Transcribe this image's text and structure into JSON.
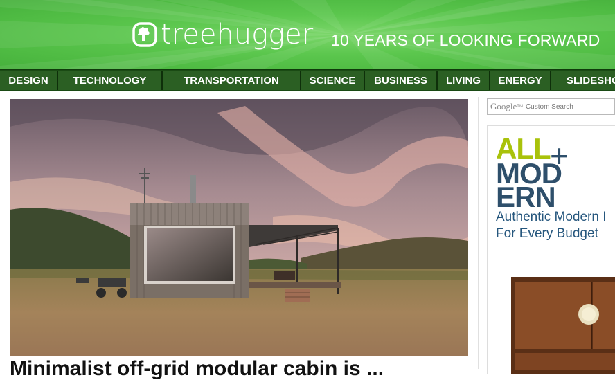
{
  "header": {
    "logo_text": "treehugger",
    "tagline": "10 YEARS OF LOOKING FORWARD"
  },
  "nav": {
    "items": [
      {
        "label": "DESIGN"
      },
      {
        "label": "TECHNOLOGY"
      },
      {
        "label": "TRANSPORTATION"
      },
      {
        "label": "SCIENCE"
      },
      {
        "label": "BUSINESS"
      },
      {
        "label": "LIVING"
      },
      {
        "label": "ENERGY"
      },
      {
        "label": "SLIDESHO"
      }
    ]
  },
  "article": {
    "title": "Minimalist off-grid modular cabin is ..."
  },
  "search": {
    "brand": "Google",
    "tm": "TM",
    "placeholder": "Custom Search"
  },
  "ad": {
    "brand_line1": "ALL",
    "brand_line2": "MOD",
    "brand_line3": "ERN",
    "tagline_line1": "Authentic Modern I",
    "tagline_line2": "For Every Budget",
    "brand_color_lime": "#a9c20b",
    "brand_color_navy": "#2e4f6b"
  },
  "colors": {
    "header_green": "#5cc74e",
    "nav_green": "#2b5f23"
  }
}
